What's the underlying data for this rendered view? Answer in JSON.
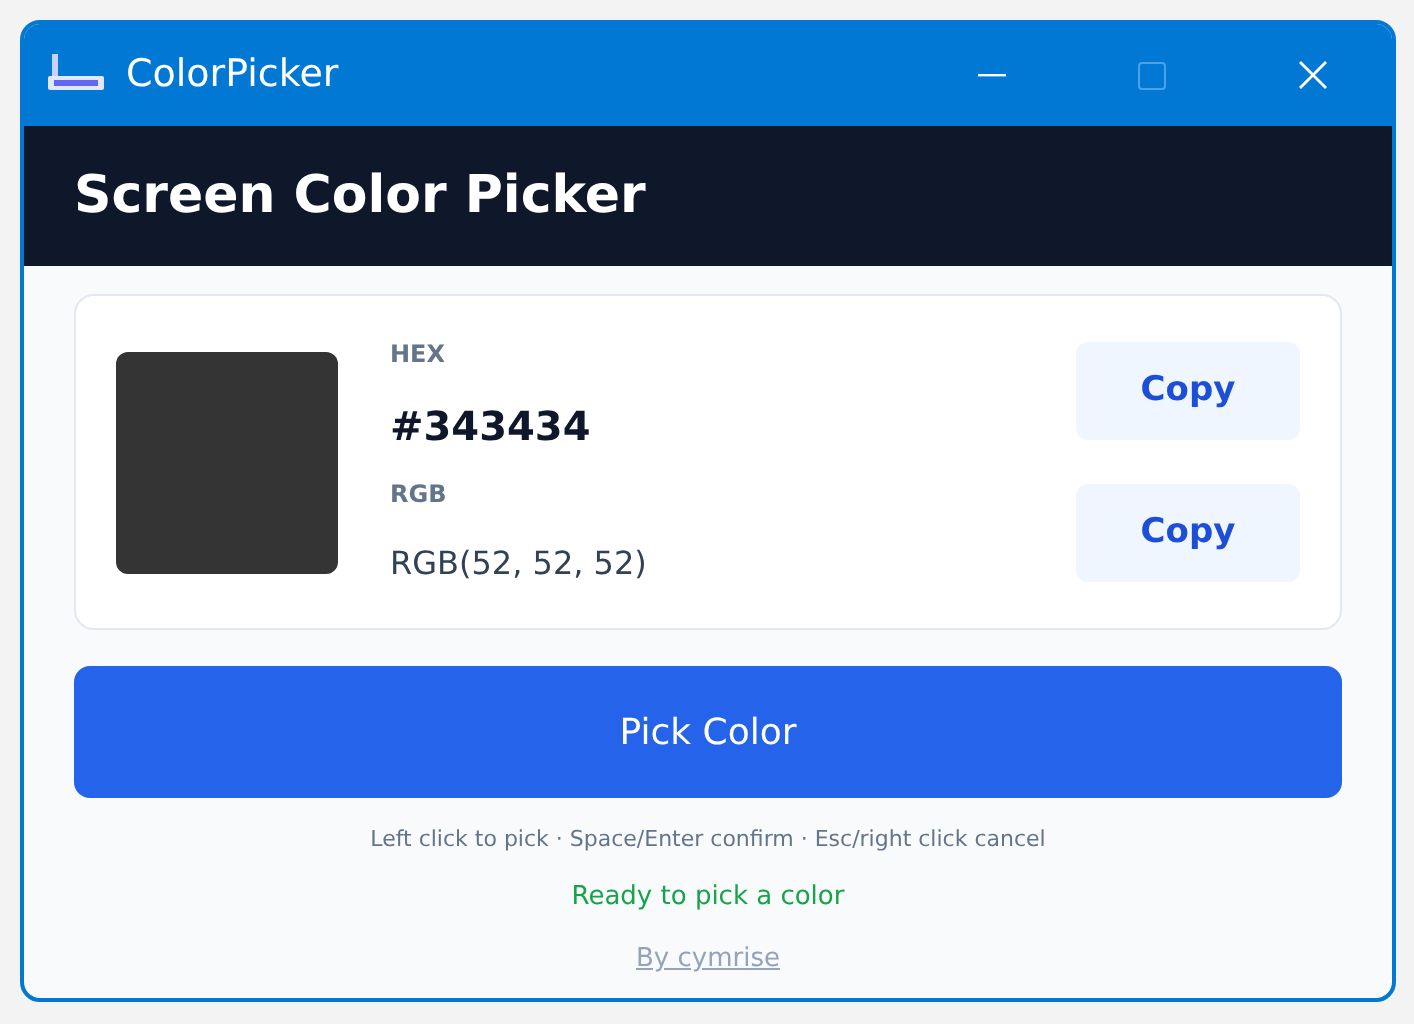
{
  "window": {
    "title": "ColorPicker",
    "maximize_disabled": true
  },
  "header": {
    "title": "Screen Color Picker"
  },
  "color": {
    "hex_label": "HEX",
    "hex": "#343434",
    "rgb_label": "RGB",
    "rgb": "RGB(52, 52, 52)"
  },
  "copy_buttons": [
    "Copy",
    "Copy"
  ],
  "pick_button": "Pick Color",
  "hint": "Left click to pick · Space/Enter confirm · Esc/right click cancel",
  "status": {
    "text": "Ready to pick a color",
    "kind": "ready"
  },
  "credit": "By cymrise"
}
